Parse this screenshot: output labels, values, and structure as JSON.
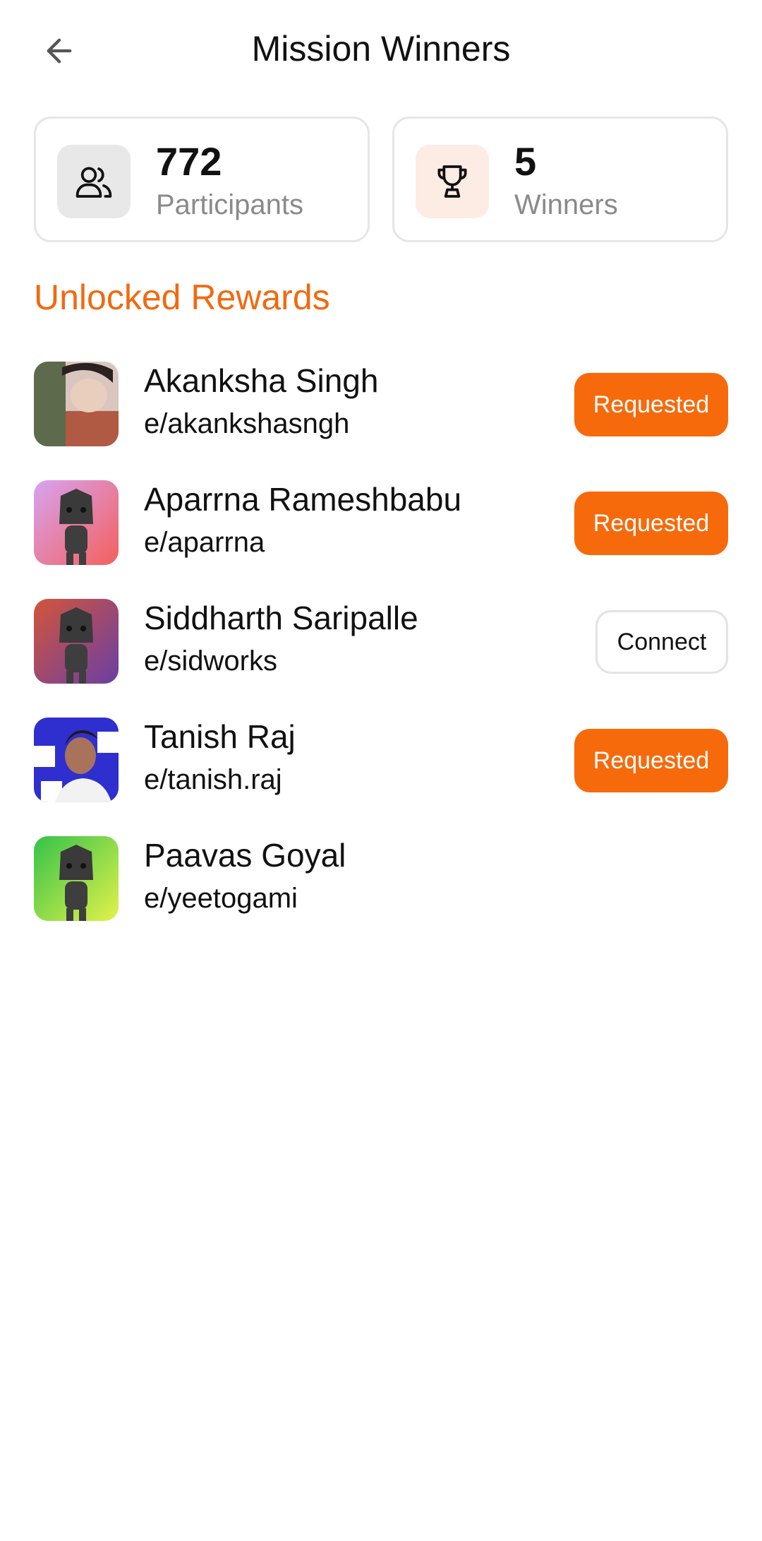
{
  "header": {
    "title": "Mission Winners",
    "back_icon": "arrow-left-icon"
  },
  "stats": {
    "participants": {
      "value": "772",
      "label": "Participants",
      "icon": "users-icon"
    },
    "winners": {
      "value": "5",
      "label": "Winners",
      "icon": "trophy-icon"
    }
  },
  "section": {
    "title": "Unlocked Rewards"
  },
  "colors": {
    "accent": "#f66a0c",
    "section_title": "#f06a10",
    "muted": "#8a8a8a"
  },
  "winners": [
    {
      "name": "Akanksha Singh",
      "handle": "e/akankshasngh",
      "action": "Requested"
    },
    {
      "name": "Aparrna Rameshbabu",
      "handle": "e/aparrna",
      "action": "Requested"
    },
    {
      "name": "Siddharth Saripalle",
      "handle": "e/sidworks",
      "action": "Connect"
    },
    {
      "name": "Tanish Raj",
      "handle": "e/tanish.raj",
      "action": "Requested"
    },
    {
      "name": "Paavas Goyal",
      "handle": "e/yeetogami",
      "action": ""
    }
  ]
}
